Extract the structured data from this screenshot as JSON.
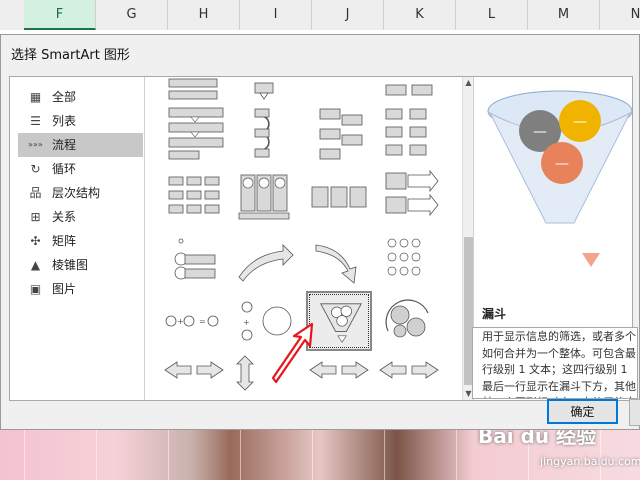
{
  "spreadsheet": {
    "columns": [
      {
        "label": "F",
        "selected": true
      },
      {
        "label": "G",
        "selected": false
      },
      {
        "label": "H",
        "selected": false
      },
      {
        "label": "I",
        "selected": false
      },
      {
        "label": "J",
        "selected": false
      },
      {
        "label": "K",
        "selected": false
      },
      {
        "label": "L",
        "selected": false
      },
      {
        "label": "M",
        "selected": false
      },
      {
        "label": "N",
        "selected": false
      }
    ]
  },
  "dialog": {
    "title": "选择 SmartArt 图形",
    "categories": [
      {
        "label": "全部",
        "icon": "all-icon",
        "selected": false
      },
      {
        "label": "列表",
        "icon": "list-icon",
        "selected": false
      },
      {
        "label": "流程",
        "icon": "process-icon",
        "selected": true
      },
      {
        "label": "循环",
        "icon": "cycle-icon",
        "selected": false
      },
      {
        "label": "层次结构",
        "icon": "hierarchy-icon",
        "selected": false
      },
      {
        "label": "关系",
        "icon": "relationship-icon",
        "selected": false
      },
      {
        "label": "矩阵",
        "icon": "matrix-icon",
        "selected": false
      },
      {
        "label": "棱锥图",
        "icon": "pyramid-icon",
        "selected": false
      },
      {
        "label": "图片",
        "icon": "picture-icon",
        "selected": false
      }
    ],
    "preview": {
      "title": "漏斗",
      "description_lines": [
        "用于显示信息的筛选，或者多个",
        "如何合并为一个整体。可包含最",
        "行级别 1 文本；这四行级别 1",
        "最后一行显示在漏斗下方，其他",
        "某一个圆形相对应。未使用的文"
      ],
      "funnel_colors": [
        "#7f7f7f",
        "#f0b400",
        "#e8825a"
      ]
    },
    "ok_label": "确定",
    "selected_layout": "funnel"
  },
  "watermark": {
    "main": "Bai du 经验",
    "sub": "jingyan.baidu.com"
  },
  "colors": {
    "accent": "#0078d7",
    "selected_column": "#217346",
    "annotation_arrow": "#e8151b"
  }
}
